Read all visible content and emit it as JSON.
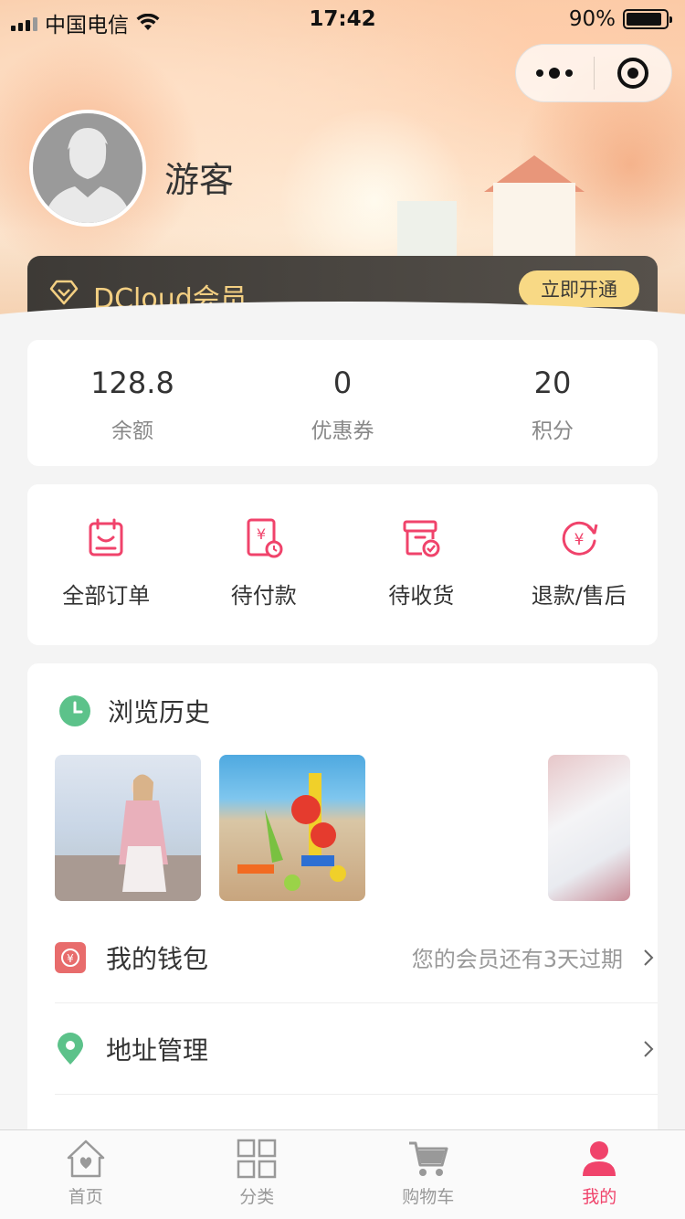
{
  "status_bar": {
    "carrier": "中国电信",
    "time": "17:42",
    "battery": "90%",
    "battery_level": 0.9
  },
  "profile": {
    "username": "游客"
  },
  "member": {
    "title": "DCloud会员",
    "button": "立即开通"
  },
  "stats": [
    {
      "value": "128.8",
      "label": "余额"
    },
    {
      "value": "0",
      "label": "优惠券"
    },
    {
      "value": "20",
      "label": "积分"
    }
  ],
  "orders": [
    {
      "label": "全部订单",
      "icon": "all-orders-icon"
    },
    {
      "label": "待付款",
      "icon": "pending-payment-icon"
    },
    {
      "label": "待收货",
      "icon": "pending-delivery-icon"
    },
    {
      "label": "退款/售后",
      "icon": "refund-icon"
    }
  ],
  "history": {
    "title": "浏览历史"
  },
  "menu": {
    "wallet": {
      "label": "我的钱包",
      "sub": "您的会员还有3天过期"
    },
    "address": {
      "label": "地址管理"
    }
  },
  "tabs": [
    {
      "label": "首页",
      "icon": "home-icon"
    },
    {
      "label": "分类",
      "icon": "category-icon"
    },
    {
      "label": "购物车",
      "icon": "cart-icon"
    },
    {
      "label": "我的",
      "icon": "user-icon",
      "active": true
    }
  ],
  "colors": {
    "accent": "#f0436b",
    "gold": "#f3cf82",
    "green": "#5cc28a"
  }
}
